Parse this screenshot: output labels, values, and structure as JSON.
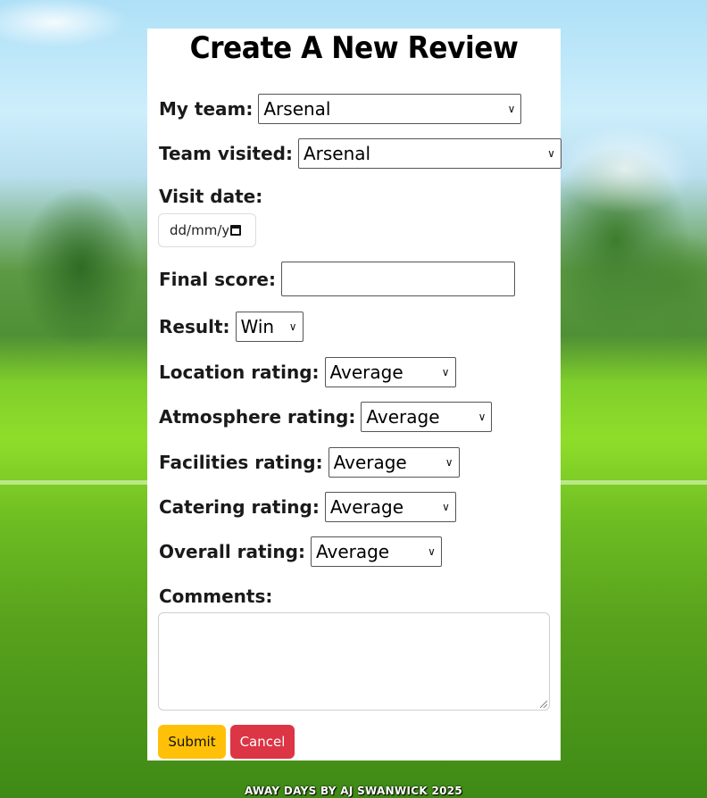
{
  "page": {
    "title": "Create A New Review",
    "footer": "AWAY DAYS BY AJ SWANWICK 2025"
  },
  "form": {
    "my_team": {
      "label": "My team:",
      "value": "Arsenal"
    },
    "team_visited": {
      "label": "Team visited:",
      "value": "Arsenal"
    },
    "visit_date": {
      "label": "Visit date:",
      "placeholder": "dd/mm/yyyy"
    },
    "final_score": {
      "label": "Final score:",
      "value": ""
    },
    "result": {
      "label": "Result:",
      "value": "Win"
    },
    "location_rating": {
      "label": "Location rating:",
      "value": "Average"
    },
    "atmosphere_rating": {
      "label": "Atmosphere rating:",
      "value": "Average"
    },
    "facilities_rating": {
      "label": "Facilities rating:",
      "value": "Average"
    },
    "catering_rating": {
      "label": "Catering rating:",
      "value": "Average"
    },
    "overall_rating": {
      "label": "Overall rating:",
      "value": "Average"
    },
    "comments": {
      "label": "Comments:",
      "value": ""
    }
  },
  "buttons": {
    "submit": "Submit",
    "cancel": "Cancel"
  },
  "colors": {
    "submit_bg": "#ffc107",
    "cancel_bg": "#dc3545"
  }
}
